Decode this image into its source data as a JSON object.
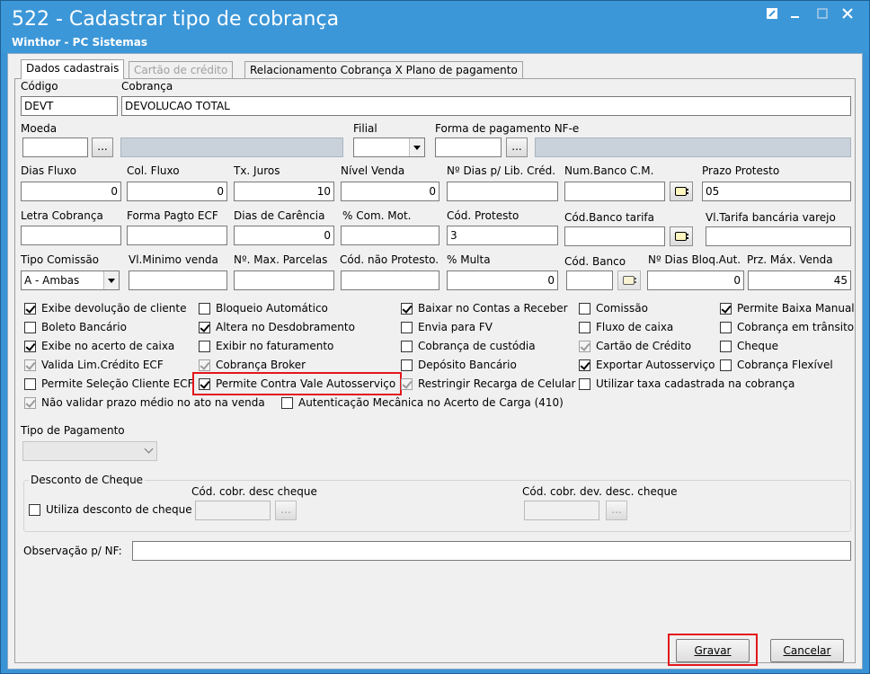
{
  "window": {
    "title": "522 - Cadastrar tipo de cobrança",
    "subtitle": "Winthor - PC Sistemas",
    "controls": [
      "restore",
      "minimize",
      "maximize",
      "close"
    ]
  },
  "tabs": [
    {
      "label": "Dados cadastrais",
      "active": true,
      "enabled": true
    },
    {
      "label": "Cartão de crédito",
      "active": false,
      "enabled": false
    },
    {
      "label": "Relacionamento Cobrança X Plano de pagamento",
      "active": false,
      "enabled": true
    }
  ],
  "fields": {
    "codigo": {
      "label": "Código",
      "value": "DEVT"
    },
    "cobranca": {
      "label": "Cobrança",
      "value": "DEVOLUCAO TOTAL"
    },
    "moeda": {
      "label": "Moeda",
      "value": "",
      "desc": ""
    },
    "filial": {
      "label": "Filial",
      "value": ""
    },
    "forma_pagamento_nfe": {
      "label": "Forma de pagamento NF-e",
      "value": "",
      "desc": ""
    },
    "dias_fluxo": {
      "label": "Dias Fluxo",
      "value": "0"
    },
    "col_fluxo": {
      "label": "Col. Fluxo",
      "value": "0"
    },
    "tx_juros": {
      "label": "Tx. Juros",
      "value": "10"
    },
    "nivel_venda": {
      "label": "Nível Venda",
      "value": "0"
    },
    "dias_lib_cred": {
      "label": "Nº Dias p/ Lib. Créd.",
      "value": ""
    },
    "num_banco_cm": {
      "label": "Num.Banco C.M.",
      "value": ""
    },
    "prazo_protesto": {
      "label": "Prazo Protesto",
      "value": "05"
    },
    "letra_cobranca": {
      "label": "Letra Cobrança",
      "value": ""
    },
    "forma_pagto_ecf": {
      "label": "Forma Pagto ECF",
      "value": ""
    },
    "dias_carencia": {
      "label": "Dias de Carência",
      "value": "0"
    },
    "com_mot": {
      "label": "% Com. Mot.",
      "value": ""
    },
    "cod_protesto": {
      "label": "Cód. Protesto",
      "value": "3"
    },
    "cod_banco_tarifa": {
      "label": "Cód.Banco tarifa",
      "value": ""
    },
    "vl_tarifa_varejo": {
      "label": "Vl.Tarifa bancária varejo",
      "value": ""
    },
    "tipo_comissao": {
      "label": "Tipo Comissão",
      "value": "A - Ambas"
    },
    "vl_minimo_venda": {
      "label": "Vl.Minimo venda",
      "value": ""
    },
    "max_parcelas": {
      "label": "Nº. Max. Parcelas",
      "value": ""
    },
    "cod_nao_protesto": {
      "label": "Cód. não Protesto.",
      "value": ""
    },
    "multa": {
      "label": "% Multa",
      "value": "0"
    },
    "cod_banco": {
      "label": "Cód. Banco",
      "value": ""
    },
    "dias_bloq_aut": {
      "label": "Nº Dias Bloq.Aut.",
      "value": "0"
    },
    "prz_max_venda": {
      "label": "Prz. Máx. Venda",
      "value": "45"
    }
  },
  "checkboxes": {
    "exibe_devolucao": {
      "label": "Exibe devolução de cliente",
      "checked": true,
      "enabled": true
    },
    "bloqueio_automatico": {
      "label": "Bloqueio Automático",
      "checked": false,
      "enabled": true
    },
    "baixar_contas_receber": {
      "label": "Baixar no Contas a Receber",
      "checked": true,
      "enabled": true
    },
    "comissao": {
      "label": "Comissão",
      "checked": false,
      "enabled": true
    },
    "permite_baixa_manual": {
      "label": "Permite Baixa Manual",
      "checked": true,
      "enabled": true
    },
    "boleto_bancario": {
      "label": "Boleto Bancário",
      "checked": false,
      "enabled": true
    },
    "altera_desdobramento": {
      "label": "Altera no Desdobramento",
      "checked": true,
      "enabled": true
    },
    "envia_fv": {
      "label": "Envia para FV",
      "checked": false,
      "enabled": true
    },
    "fluxo_caixa": {
      "label": "Fluxo de caixa",
      "checked": false,
      "enabled": true
    },
    "cobranca_transito": {
      "label": "Cobrança em trânsito",
      "checked": false,
      "enabled": true
    },
    "exibe_acerto_caixa": {
      "label": "Exibe no acerto de caixa",
      "checked": true,
      "enabled": true
    },
    "exibir_faturamento": {
      "label": "Exibir no faturamento",
      "checked": false,
      "enabled": true
    },
    "cobranca_custodia": {
      "label": "Cobrança de custódia",
      "checked": false,
      "enabled": true
    },
    "cartao_credito": {
      "label": "Cartão de Crédito",
      "checked": true,
      "enabled": false
    },
    "cheque": {
      "label": "Cheque",
      "checked": false,
      "enabled": true
    },
    "valida_lim_credito": {
      "label": "Valida Lim.Crédito ECF",
      "checked": true,
      "enabled": false
    },
    "cobranca_broker": {
      "label": "Cobrança Broker",
      "checked": true,
      "enabled": false
    },
    "deposito_bancario": {
      "label": "Depósito Bancário",
      "checked": false,
      "enabled": true
    },
    "exportar_autosservico": {
      "label": "Exportar Autosserviço",
      "checked": true,
      "enabled": true
    },
    "cobranca_flexivel": {
      "label": "Cobrança Flexível",
      "checked": false,
      "enabled": true
    },
    "permite_selecao_cliente_ecf": {
      "label": "Permite Seleção Cliente ECF",
      "checked": false,
      "enabled": true
    },
    "permite_contra_vale": {
      "label": "Permite Contra Vale Autosserviço",
      "checked": true,
      "enabled": true
    },
    "restringir_recarga": {
      "label": "Restringir Recarga de Celular",
      "checked": true,
      "enabled": false
    },
    "utilizar_taxa": {
      "label": "Utilizar taxa cadastrada na cobrança",
      "checked": false,
      "enabled": true
    },
    "nao_validar_prazo": {
      "label": "Não validar prazo médio no ato na venda",
      "checked": true,
      "enabled": false
    },
    "autenticacao_mecanica": {
      "label": "Autenticação Mecânica no Acerto de Carga (410)",
      "checked": false,
      "enabled": true
    }
  },
  "tipo_pagamento": {
    "label": "Tipo de Pagamento",
    "value": ""
  },
  "desconto_cheque": {
    "title": "Desconto de Cheque",
    "utiliza_label": "Utiliza desconto de cheque",
    "utiliza_checked": false,
    "cod_cobr_desc_label": "Cód. cobr. desc cheque",
    "cod_cobr_desc_value": "",
    "cod_cobr_dev_label": "Cód. cobr. dev. desc. cheque",
    "cod_cobr_dev_value": ""
  },
  "observacao": {
    "label": "Observação p/ NF:",
    "value": ""
  },
  "buttons": {
    "gravar": "Gravar",
    "cancelar": "Cancelar"
  },
  "dots_label": "...",
  "colors": {
    "titlebar": "#3c97d8",
    "highlight": "#e3161c",
    "disabled_field": "#c9d2da"
  }
}
